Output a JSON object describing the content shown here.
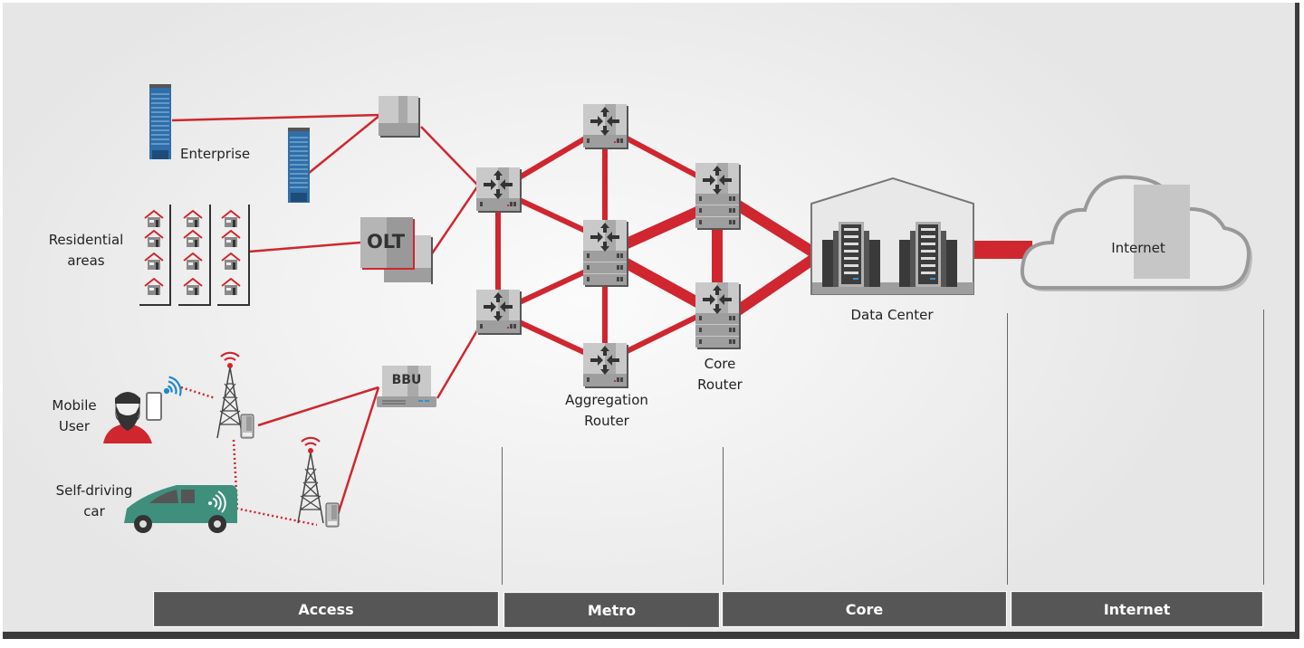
{
  "labels": {
    "enterprise": "Enterprise",
    "residential": "Residential\nareas",
    "residential_line1": "Residential",
    "residential_line2": "areas",
    "mobile_line1": "Mobile",
    "mobile_line2": "User",
    "car_line1": "Self-driving",
    "car_line2": "car",
    "olt": "OLT",
    "bbu": "BBU",
    "aggregation_line1": "Aggregation",
    "aggregation_line2": "Router",
    "core_line1": "Core",
    "core_line2": "Router",
    "data_center": "Data Center",
    "internet_cloud": "Internet"
  },
  "sections": [
    {
      "id": "access",
      "label": "Access"
    },
    {
      "id": "metro",
      "label": "Metro"
    },
    {
      "id": "core",
      "label": "Core"
    },
    {
      "id": "internet",
      "label": "Internet"
    }
  ],
  "colors": {
    "link": "#d0262f",
    "device": "#c4c4c4",
    "device_dark": "#9a9a9a",
    "band": "#565656",
    "building": "#2f6ea8",
    "car": "#3f8f7d",
    "wifi_blue": "#1e88d0"
  }
}
